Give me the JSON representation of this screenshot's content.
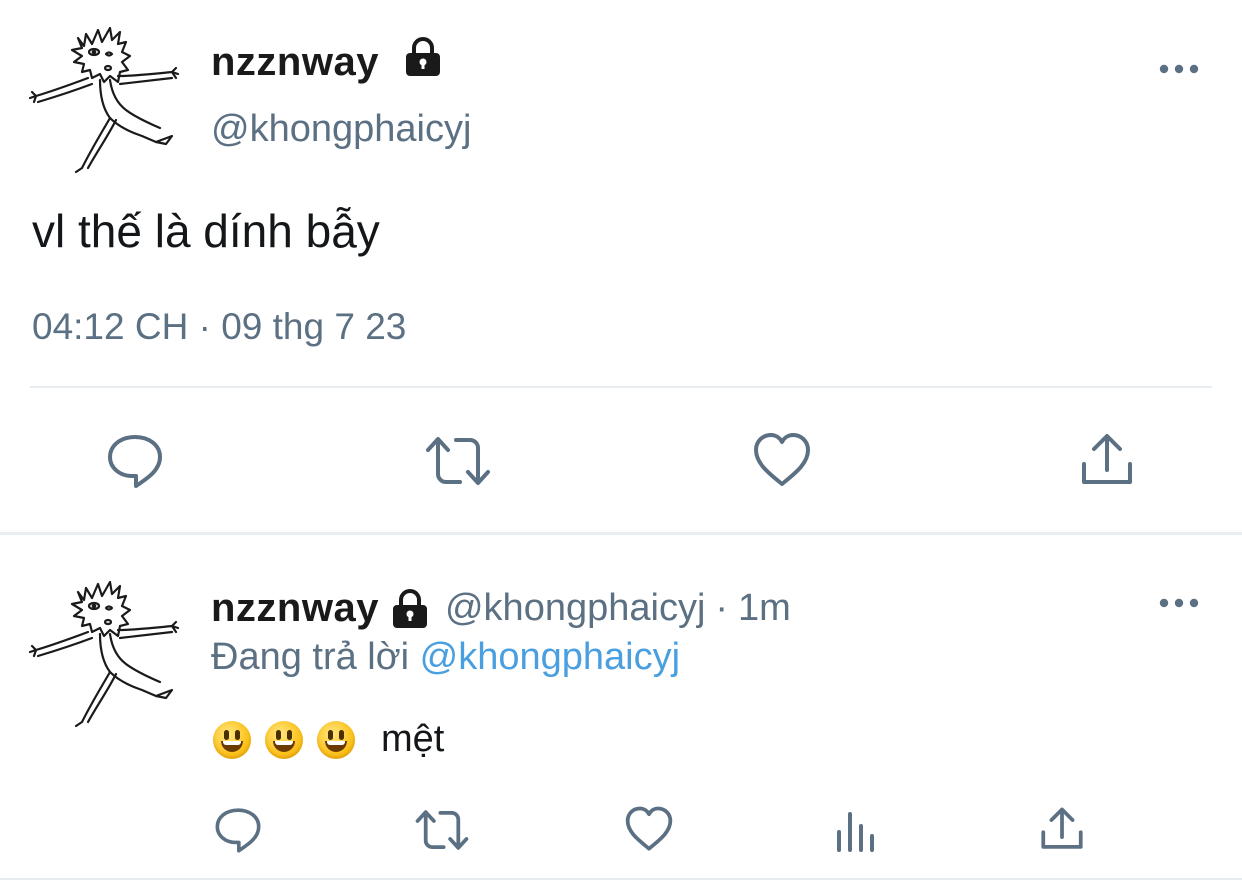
{
  "main_tweet": {
    "avatar": "stick-figure-drawing",
    "display_name": "nzznway",
    "protected_icon": "lock-icon",
    "handle": "@khongphaicyj",
    "text": "vl thế là dính bẫy",
    "timestamp": "04:12 CH · 09 thg 7 23",
    "more_icon": "more-horizontal-icon",
    "actions": [
      "reply-icon",
      "retweet-icon",
      "like-icon",
      "share-icon"
    ]
  },
  "reply_tweet": {
    "avatar": "stick-figure-drawing",
    "display_name": "nzznway",
    "protected_icon": "lock-icon",
    "handle": "@khongphaicyj",
    "separator": "·",
    "time": "1m",
    "replying_prefix": "Đang trả lời",
    "replying_to": "@khongphaicyj",
    "emojis": [
      "😃",
      "😃",
      "😃"
    ],
    "text": "mệt",
    "more_icon": "more-horizontal-icon",
    "actions": [
      "reply-icon",
      "retweet-icon",
      "like-icon",
      "analytics-icon",
      "share-icon"
    ]
  },
  "colors": {
    "link": "#4a9fe0",
    "secondary_text": "#5b7083",
    "icon": "#5b7083",
    "divider": "#e6ecf0"
  }
}
